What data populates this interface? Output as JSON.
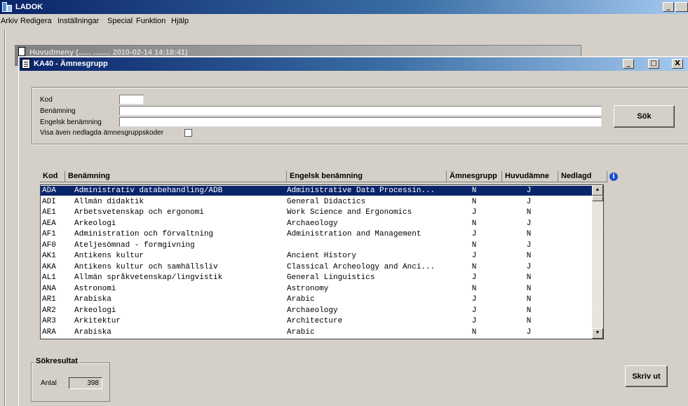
{
  "app": {
    "title": "LADOK",
    "menu": [
      "Arkiv",
      "Redigera",
      "Inställningar",
      "Special",
      "Funktion",
      "Hjälp"
    ]
  },
  "background_window": {
    "title": "Huvudmeny (...... ........ 2010-02-14 14:18:41)"
  },
  "window": {
    "title": "KA40 - Ämnesgrupp",
    "min": "_",
    "max": "□",
    "close": "X"
  },
  "search": {
    "kod_label": "Kod",
    "kod_value": "",
    "benamning_label": "Benämning",
    "benamning_value": "",
    "engelsk_label": "Engelsk benämning",
    "engelsk_value": "",
    "visa_label": "Visa även nedlagda ämnesgruppskoder",
    "visa_checked": false,
    "sok_button": "Sök"
  },
  "table": {
    "headers": [
      "Kod",
      "Benämning",
      "Engelsk benämning",
      "Ämnesgrupp",
      "Huvudämne",
      "Nedlagd"
    ],
    "info_icon": "info-icon",
    "rows": [
      {
        "kod": "ADA",
        "ben": "Administrativ databehandling/ADB",
        "eng": "Administrative Data Processin...",
        "amn": "N",
        "huv": "J",
        "ned": ""
      },
      {
        "kod": "ADI",
        "ben": "Allmän didaktik",
        "eng": "General Didactics",
        "amn": "N",
        "huv": "J",
        "ned": ""
      },
      {
        "kod": "AE1",
        "ben": "Arbetsvetenskap och ergonomi",
        "eng": "Work Science and Ergonomics",
        "amn": "J",
        "huv": "N",
        "ned": ""
      },
      {
        "kod": "AEA",
        "ben": "Arkeologi",
        "eng": "Archaeology",
        "amn": "N",
        "huv": "J",
        "ned": ""
      },
      {
        "kod": "AF1",
        "ben": "Administration och förvaltning",
        "eng": "Administration and Management",
        "amn": "J",
        "huv": "N",
        "ned": ""
      },
      {
        "kod": "AF0",
        "ben": "Ateljesömnad - formgivning",
        "eng": "",
        "amn": "N",
        "huv": "J",
        "ned": ""
      },
      {
        "kod": "AK1",
        "ben": "Antikens kultur",
        "eng": "Ancient History",
        "amn": "J",
        "huv": "N",
        "ned": ""
      },
      {
        "kod": "AKA",
        "ben": "Antikens kultur och samhällsliv",
        "eng": "Classical Archeology and Anci...",
        "amn": "N",
        "huv": "J",
        "ned": ""
      },
      {
        "kod": "AL1",
        "ben": "Allmän språkvetenskap/lingvistik",
        "eng": "General Linguistics",
        "amn": "J",
        "huv": "N",
        "ned": ""
      },
      {
        "kod": "ANA",
        "ben": "Astronomi",
        "eng": "Astronomy",
        "amn": "N",
        "huv": "N",
        "ned": ""
      },
      {
        "kod": "AR1",
        "ben": "Arabiska",
        "eng": "Arabic",
        "amn": "J",
        "huv": "N",
        "ned": ""
      },
      {
        "kod": "AR2",
        "ben": "Arkeologi",
        "eng": "Archaeology",
        "amn": "J",
        "huv": "N",
        "ned": ""
      },
      {
        "kod": "AR3",
        "ben": "Arkitektur",
        "eng": "Architecture",
        "amn": "J",
        "huv": "N",
        "ned": ""
      },
      {
        "kod": "ARA",
        "ben": "Arabiska",
        "eng": "Arabic",
        "amn": "N",
        "huv": "J",
        "ned": ""
      }
    ]
  },
  "results": {
    "legend": "Sökresultat",
    "antal_label": "Antal",
    "antal_value": "398",
    "print_button": "Skriv ut"
  },
  "colors": {
    "selection": "#0a246a",
    "window_face": "#d4d0c8"
  }
}
